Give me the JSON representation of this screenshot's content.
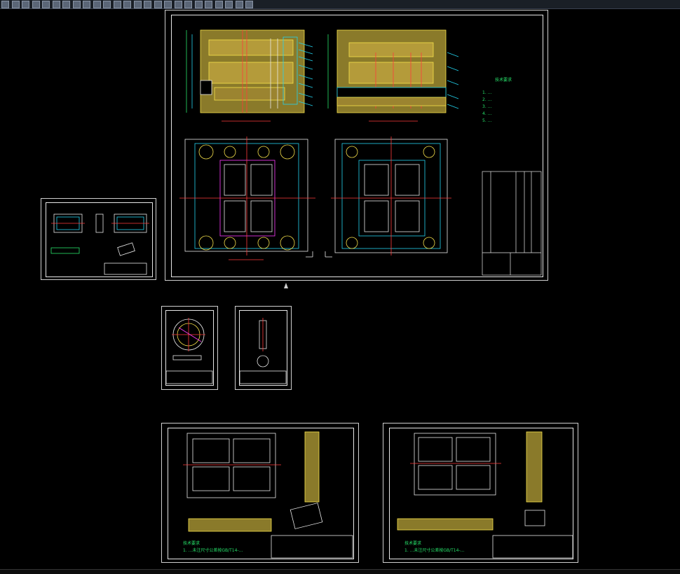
{
  "app": {
    "accent": "#22d3ee",
    "drawing_bg": "#000000"
  },
  "toolbar": {
    "icons": [
      "open-icon",
      "save-icon",
      "print-icon",
      "layer-icon",
      "zoom-icon",
      "pan-icon",
      "grid-icon",
      "snap-icon",
      "ortho-icon",
      "polar-icon",
      "osnap-icon",
      "otrack-icon",
      "lineweight-icon",
      "model-icon",
      "layout-icon",
      "plot-icon",
      "properties-icon",
      "match-icon",
      "measure-icon",
      "block-icon",
      "insert-icon",
      "text-icon",
      "dim-icon",
      "hatch-icon",
      "table-icon"
    ]
  },
  "sheets": {
    "assembly": {
      "notes_title": "技术要求",
      "notes": [
        "1. ...",
        "2. ...",
        "3. ...",
        "4. ...",
        "5. ..."
      ]
    },
    "part_small": {},
    "ring": {},
    "pin": {},
    "cavity": {
      "tech_title": "技术要求",
      "tech_line": "1. ...未注尺寸公差按GB/T14-..."
    },
    "core": {
      "tech_title": "技术要求",
      "tech_line": "1. ...未注尺寸公差按GB/T14-..."
    }
  }
}
